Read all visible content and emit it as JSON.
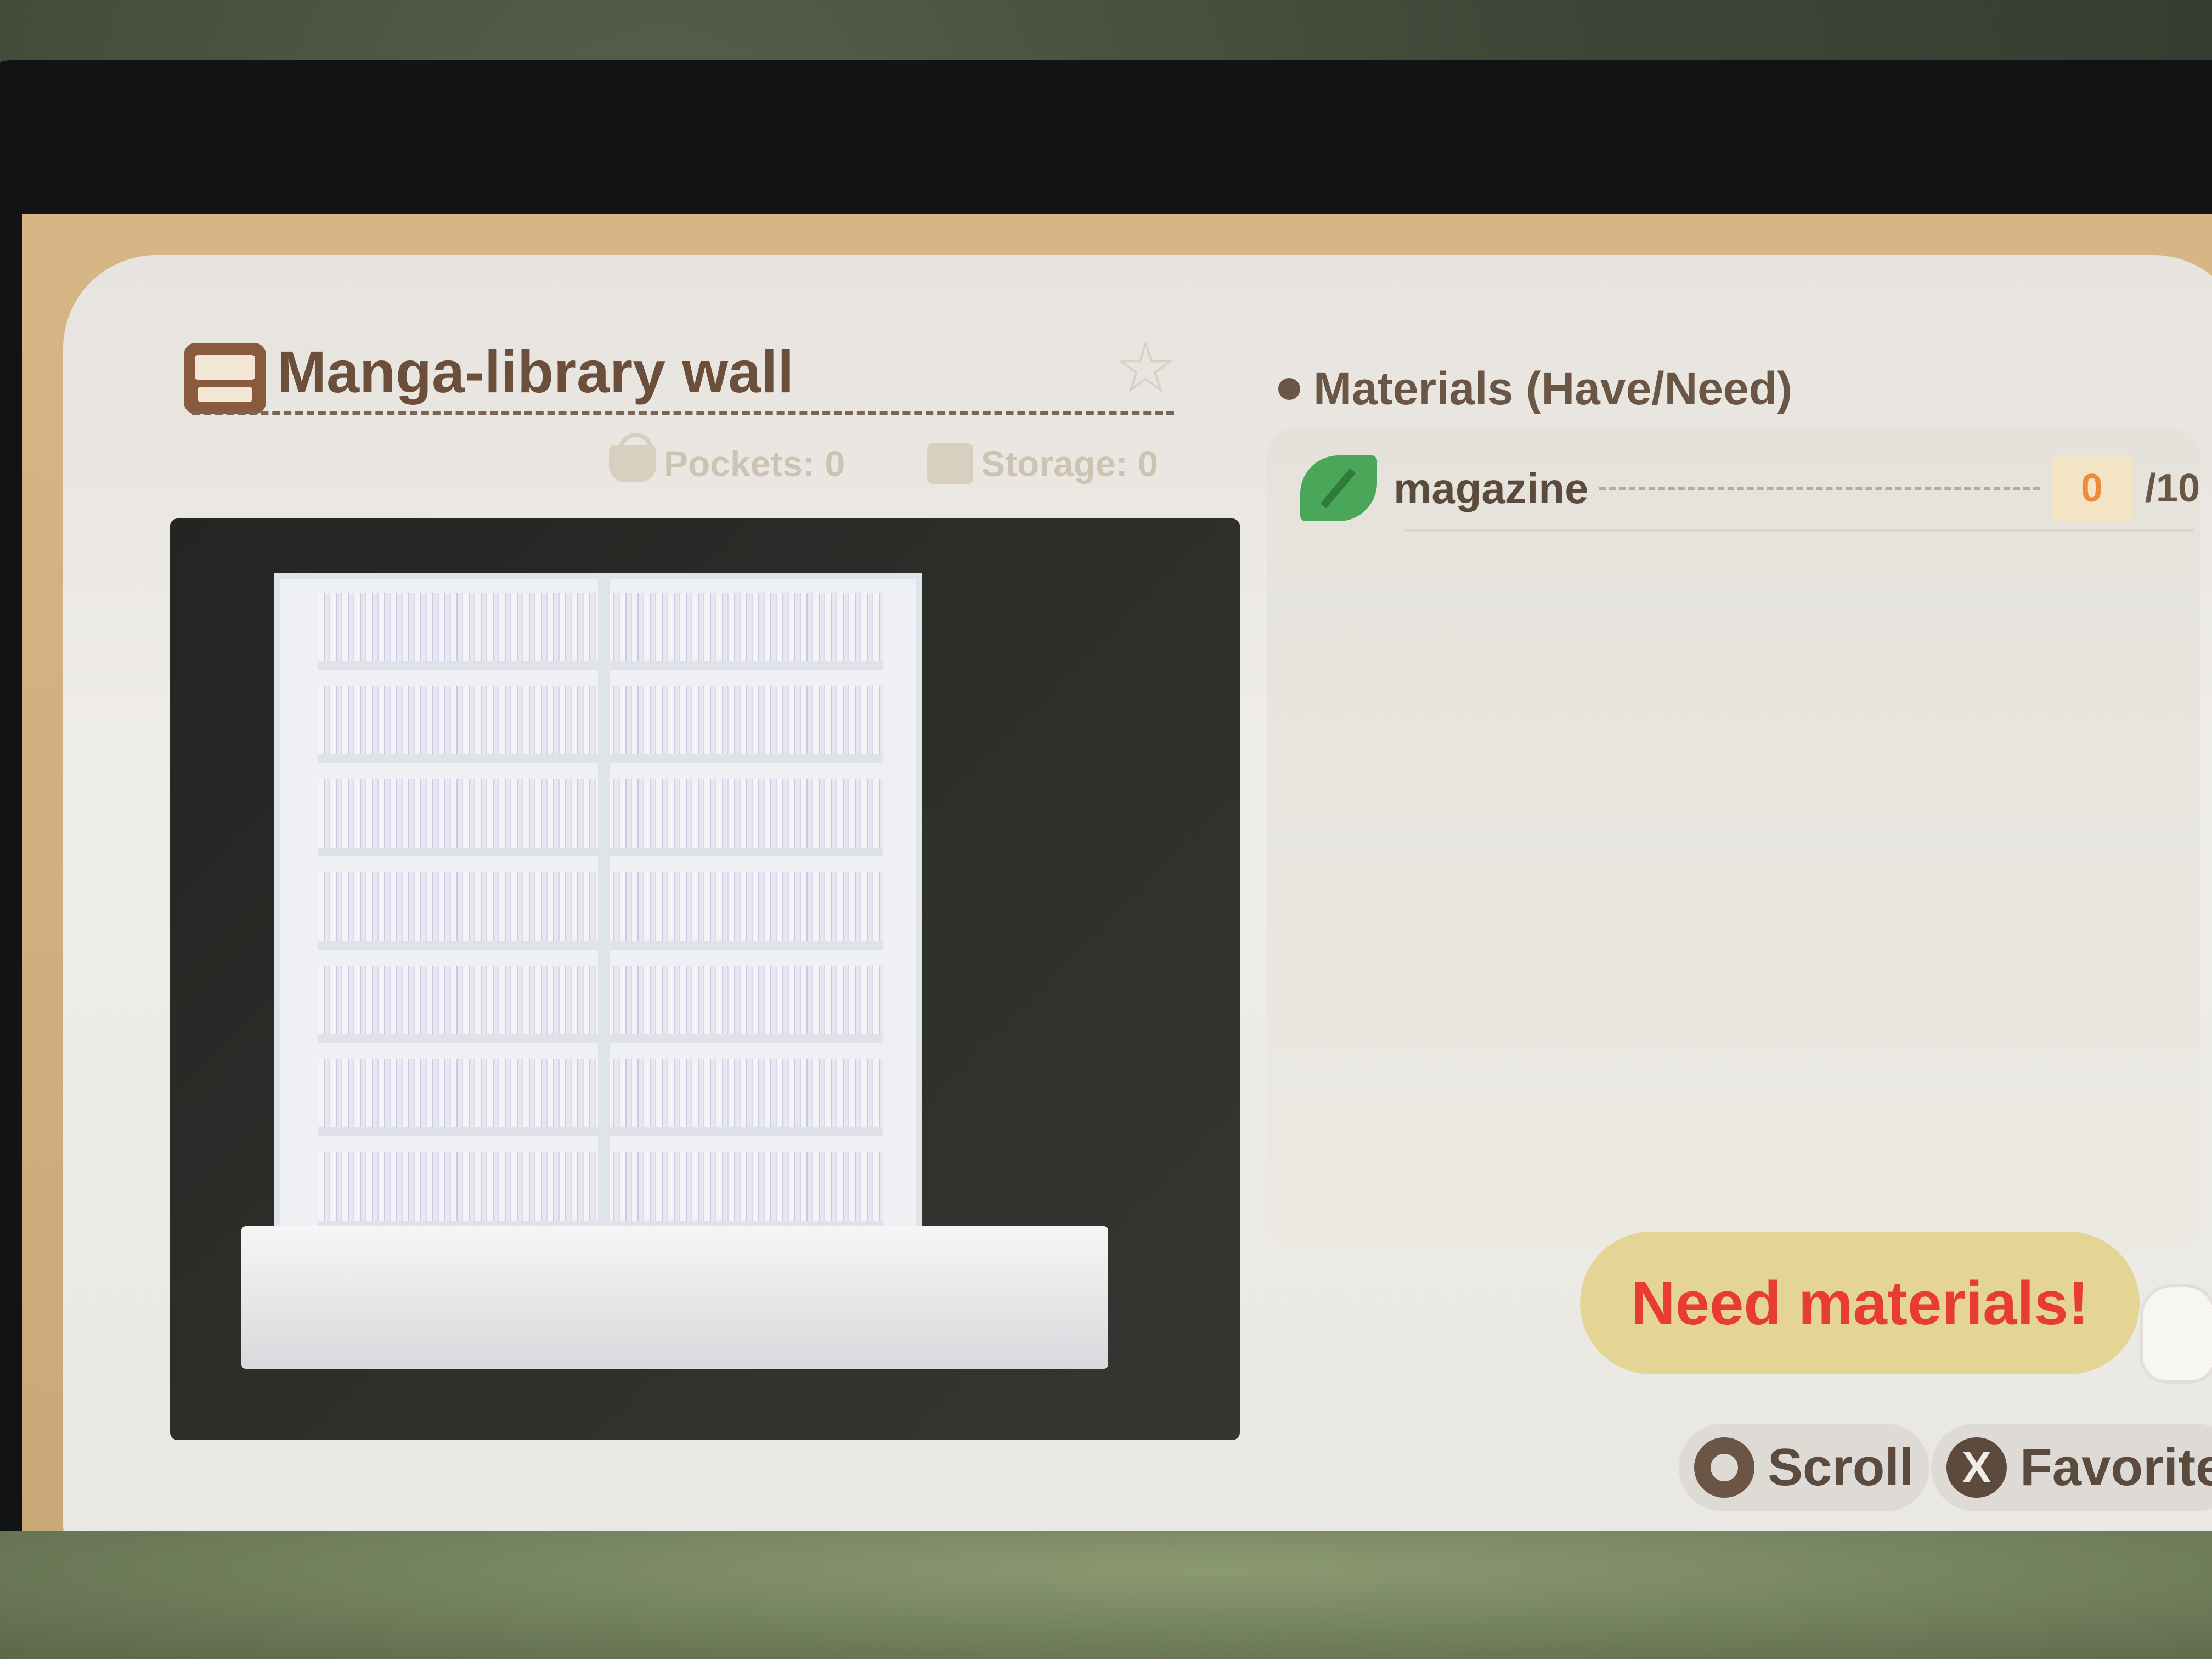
{
  "item": {
    "name": "Manga-library wall",
    "pockets": "Pockets: 0",
    "storage": "Storage: 0",
    "icon": "diy-recipe-icon",
    "favorite_icon": "star-icon"
  },
  "materials": {
    "header": "Materials (Have/Need)",
    "items": [
      {
        "name": "magazine",
        "have": "0",
        "need": "/10",
        "icon": "leaf-icon"
      }
    ]
  },
  "actions": {
    "need_materials": "Need materials!",
    "scroll_label": "Scroll",
    "favorite_label": "Favorite",
    "favorite_button_glyph": "X"
  },
  "colors": {
    "accent_red": "#e63c33",
    "have_orange": "#f08a3a",
    "button_yellow": "#e4d595",
    "text_brown": "#6b5645"
  }
}
